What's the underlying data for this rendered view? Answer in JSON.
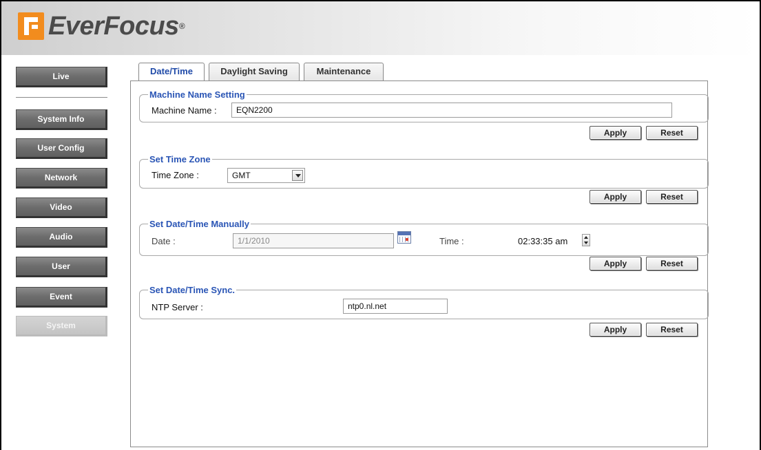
{
  "brand": {
    "name": "EverFocus",
    "registered": "®"
  },
  "sidebar": {
    "items": [
      {
        "label": "Live"
      },
      {
        "label": "System Info"
      },
      {
        "label": "User Config"
      },
      {
        "label": "Network"
      },
      {
        "label": "Video"
      },
      {
        "label": "Audio"
      },
      {
        "label": "User"
      },
      {
        "label": "Event"
      },
      {
        "label": "System"
      }
    ],
    "active": "System"
  },
  "tabs": [
    {
      "label": "Date/Time"
    },
    {
      "label": "Daylight Saving"
    },
    {
      "label": "Maintenance"
    }
  ],
  "machine_name": {
    "legend": "Machine Name Setting",
    "label": "Machine Name :",
    "value": "EQN2200"
  },
  "time_zone": {
    "legend": "Set Time Zone",
    "label": "Time Zone :",
    "value": "GMT"
  },
  "manual": {
    "legend": "Set Date/Time Manually",
    "date_label": "Date :",
    "date_value": "1/1/2010",
    "time_label": "Time :",
    "time_value": "02:33:35 am"
  },
  "sync": {
    "legend": "Set Date/Time Sync.",
    "ntp_label": "NTP Server :",
    "ntp_value": "ntp0.nl.net"
  },
  "buttons": {
    "apply": "Apply",
    "reset": "Reset"
  },
  "colors": {
    "accent_blue": "#2a55b5",
    "brand_orange": "#f28c1e",
    "nav_gray": "#6d6d6d"
  }
}
